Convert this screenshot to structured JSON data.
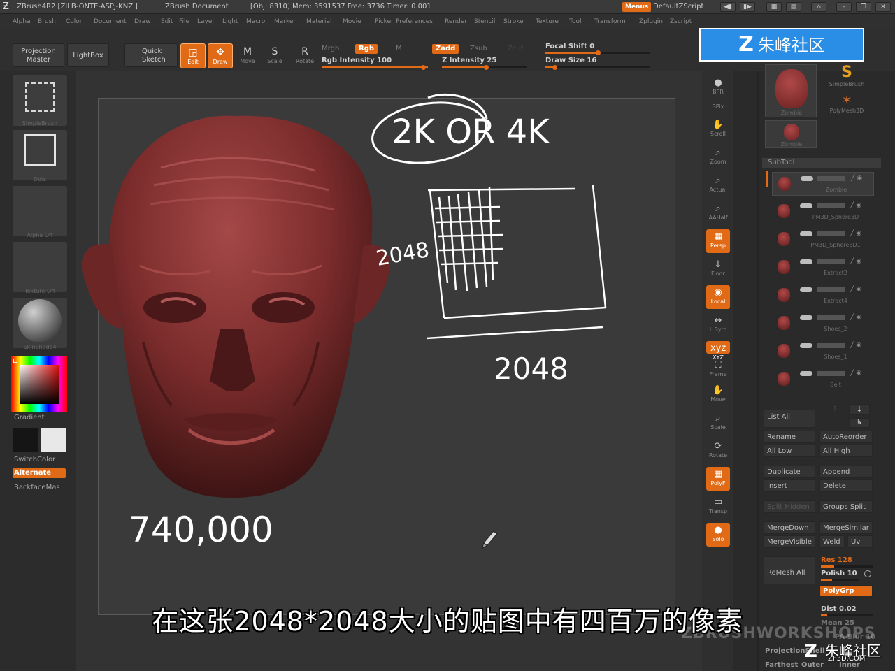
{
  "titlebar": {
    "app_title": "ZBrush4R2 [ZILB-ONTE-ASPJ-KNZI]",
    "document": "ZBrush Document",
    "status": "[Obj: 8310] Mem: 3591537 Free: 3736 Timer: 0.001",
    "menus_label": "Menus",
    "script_label": "DefaultZScript"
  },
  "menubar": {
    "items": [
      "Alpha",
      "Brush",
      "Color",
      "Document",
      "Draw",
      "Edit",
      "File",
      "Layer",
      "Light",
      "Macro",
      "Marker",
      "Material",
      "Movie",
      "Picker",
      "Preferences",
      "Render",
      "Stencil",
      "Stroke",
      "Texture",
      "Tool",
      "Transform",
      "Zplugin",
      "Zscript"
    ]
  },
  "shelf": {
    "projection_master": "Projection Master",
    "lightbox": "LightBox",
    "quick_sketch": "Quick Sketch",
    "tools": [
      "Edit",
      "Draw",
      "Move",
      "Scale",
      "Rotate"
    ],
    "mrgb": "Mrgb",
    "rgb": "Rgb",
    "m": "M",
    "rgb_intensity": "Rgb Intensity 100",
    "zadd": "Zadd",
    "zsub": "Zsub",
    "zcut": "Zcut",
    "z_intensity": "Z Intensity 25",
    "focal_shift": "Focal Shift 0",
    "draw_size": "Draw Size 16"
  },
  "left_panel": {
    "slot_captions": [
      "SimpleBrush",
      "Dots",
      "Alpha Off",
      "Texture Off",
      "SkinShade4"
    ],
    "gradient": "Gradient",
    "switch_color": "SwitchColor",
    "alternate": "Alternate",
    "backface": "BackfaceMas"
  },
  "canvas": {
    "annotation_top": "2K OR 4K",
    "annotation_side": "2048",
    "annotation_bottom": "2048",
    "annotation_count": "740,000"
  },
  "right_strip": {
    "buttons": [
      "BPR",
      "SPix",
      "Scroll",
      "Zoom",
      "Actual",
      "AAHalf",
      "Persp",
      "Floor",
      "Local",
      "L.Sym",
      "XYZ",
      "Frame",
      "Move",
      "Scale",
      "Rotate",
      "PolyF",
      "Transp",
      "Solo"
    ]
  },
  "right_panel": {
    "tools_top": [
      {
        "name": "Zombie",
        "label": "Zombie"
      },
      {
        "name": "SimpleBrush",
        "label": "SimpleBrush"
      },
      {
        "name": "PolyMesh3D",
        "label": "PolyMesh3D"
      },
      {
        "name": "Zombie2",
        "label": "Zombie"
      }
    ],
    "subtool_header": "SubTool",
    "subtools": [
      "Zombie",
      "PM3D_Sphere3D",
      "PM3D_Sphere3D1",
      "Extract2",
      "Extract4",
      "Shoes_2",
      "Shoes_1",
      "Belt"
    ],
    "list_all": "List All",
    "rename": "Rename",
    "auto_reorder": "AutoReorder",
    "all_low": "All Low",
    "all_high": "All High",
    "duplicate": "Duplicate",
    "append": "Append",
    "insert": "Insert",
    "delete": "Delete",
    "split_hidden": "Split Hidden",
    "groups_split": "Groups Split",
    "merge_down": "MergeDown",
    "merge_similar": "MergeSimilar",
    "merge_visible": "MergeVisible",
    "weld": "Weld",
    "uv": "Uv",
    "remesh_all": "ReMesh All",
    "res": "Res 128",
    "polish": "Polish 10",
    "polygrp": "PolyGrp",
    "dist": "Dist 0.02",
    "mean": "Mean 25",
    "pa_blur": "PA Blur 10",
    "projection_shell": "ProjectionShell",
    "farthest": "Farthest",
    "outer": "Outer",
    "inner": "Inner"
  },
  "overlay": {
    "watermark_text": "朱峰社区",
    "subtitle": "在这张2048*2048大小的贴图中有四百万的像素",
    "bottom_watermark": "ZBRUSHWORKSHOPS",
    "site_name": "朱峰社区",
    "site_url": "ZF3D.COM"
  },
  "colors": {
    "accent": "#e06a16",
    "background": "#2e2e2e",
    "canvas": "#3a3a3a",
    "sculpt": "#7a2c2c",
    "watermark_blue": "#2a8ee6"
  }
}
